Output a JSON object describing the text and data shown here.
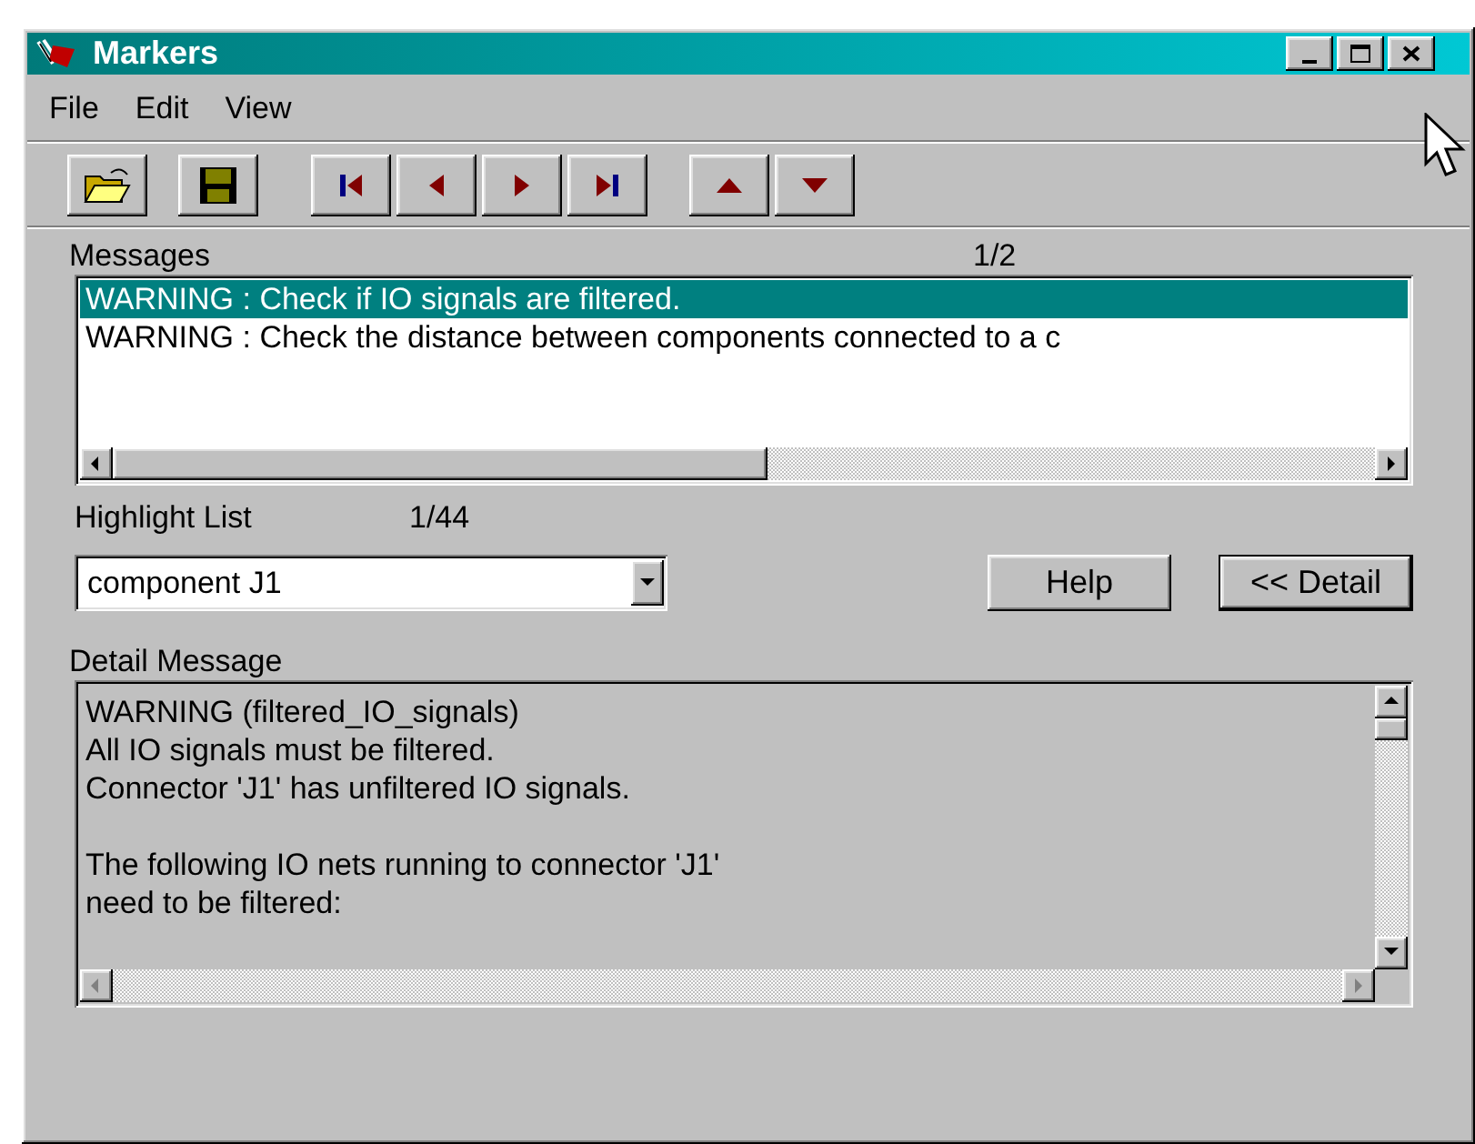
{
  "window": {
    "title": "Markers"
  },
  "menu": [
    "File",
    "Edit",
    "View"
  ],
  "messages": {
    "label": "Messages",
    "counter": "1/2",
    "items": [
      {
        "text": "WARNING : Check if IO signals are filtered.",
        "selected": true
      },
      {
        "text": "WARNING : Check the distance between components connected to a c",
        "selected": false
      }
    ]
  },
  "highlight_list": {
    "label": "Highlight List",
    "counter": "1/44",
    "value": "component J1"
  },
  "buttons": [
    {
      "label": "Help",
      "default": false
    },
    {
      "label": "<< Detail",
      "default": true
    }
  ],
  "detail": {
    "label": "Detail Message",
    "paragraphs": [
      [
        "WARNING (filtered_IO_signals)",
        "All IO signals must be filtered.",
        "Connector 'J1' has unfiltered IO signals."
      ],
      [
        "The following IO nets running to connector 'J1'",
        "need to be filtered:"
      ]
    ]
  }
}
